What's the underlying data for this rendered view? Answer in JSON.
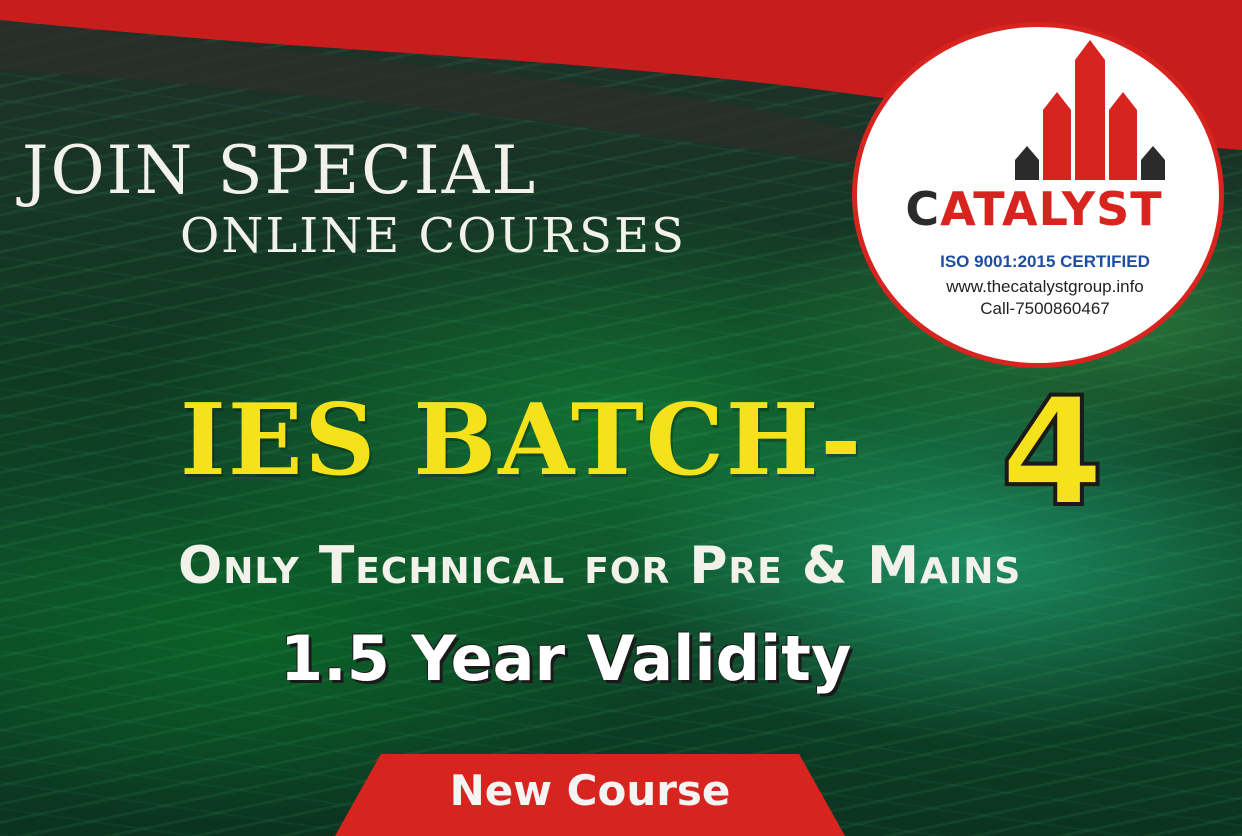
{
  "heading": {
    "line1": "JOIN SPECIAL",
    "line2": "ONLINE COURSES"
  },
  "logo": {
    "brand_first": "C",
    "brand_rest": "ATALYST",
    "certification": "ISO 9001:2015 CERTIFIED",
    "website": "www.thecatalystgroup.info",
    "phone": "Call-7500860467"
  },
  "batch": {
    "title": "IES BATCH-",
    "number": "4"
  },
  "subtitle": "Only Technical  for Pre & Mains",
  "validity": "1.5 Year Validity",
  "badge": {
    "label": "New Course"
  },
  "colors": {
    "brand_red": "#d8241f",
    "headline_yellow": "#f5e21a",
    "background_green": "#0e4a2a",
    "text_light": "#f2f2ea",
    "iso_blue": "#1f4ea1"
  },
  "icons": {
    "logo_mark": "catalyst-building-arrows-icon"
  }
}
